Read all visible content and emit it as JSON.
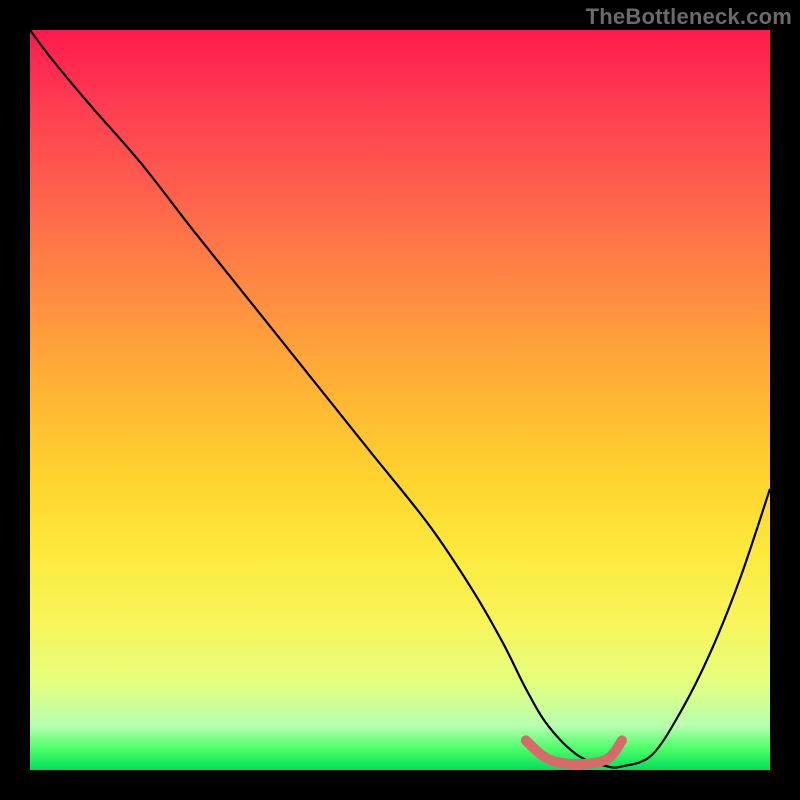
{
  "watermark": "TheBottleneck.com",
  "chart_data": {
    "type": "line",
    "title": "",
    "xlabel": "",
    "ylabel": "",
    "xlim": [
      0,
      100
    ],
    "ylim": [
      0,
      100
    ],
    "grid": false,
    "legend": false,
    "series": [
      {
        "name": "bottleneck-curve",
        "color": "#000000",
        "x": [
          0,
          3,
          8,
          15,
          22,
          30,
          38,
          46,
          54,
          60,
          64,
          67,
          70,
          74,
          78,
          80,
          84,
          88,
          92,
          96,
          100
        ],
        "y": [
          100,
          96,
          90,
          82,
          73,
          63,
          53,
          43,
          33,
          24,
          17,
          11,
          6,
          2,
          0.5,
          0.5,
          2,
          8,
          16,
          26,
          38
        ]
      },
      {
        "name": "highlight-band",
        "color": "#d86a6a",
        "x": [
          67,
          70,
          74,
          78,
          80
        ],
        "y": [
          4,
          1.5,
          0.8,
          1.5,
          4
        ]
      }
    ]
  },
  "colors": {
    "background": "#000000",
    "gradient_top": "#ff1a4d",
    "gradient_mid": "#ffd22e",
    "gradient_bottom": "#00e05a",
    "curve": "#000000",
    "highlight": "#d86a6a",
    "watermark": "#6a6a6a"
  }
}
